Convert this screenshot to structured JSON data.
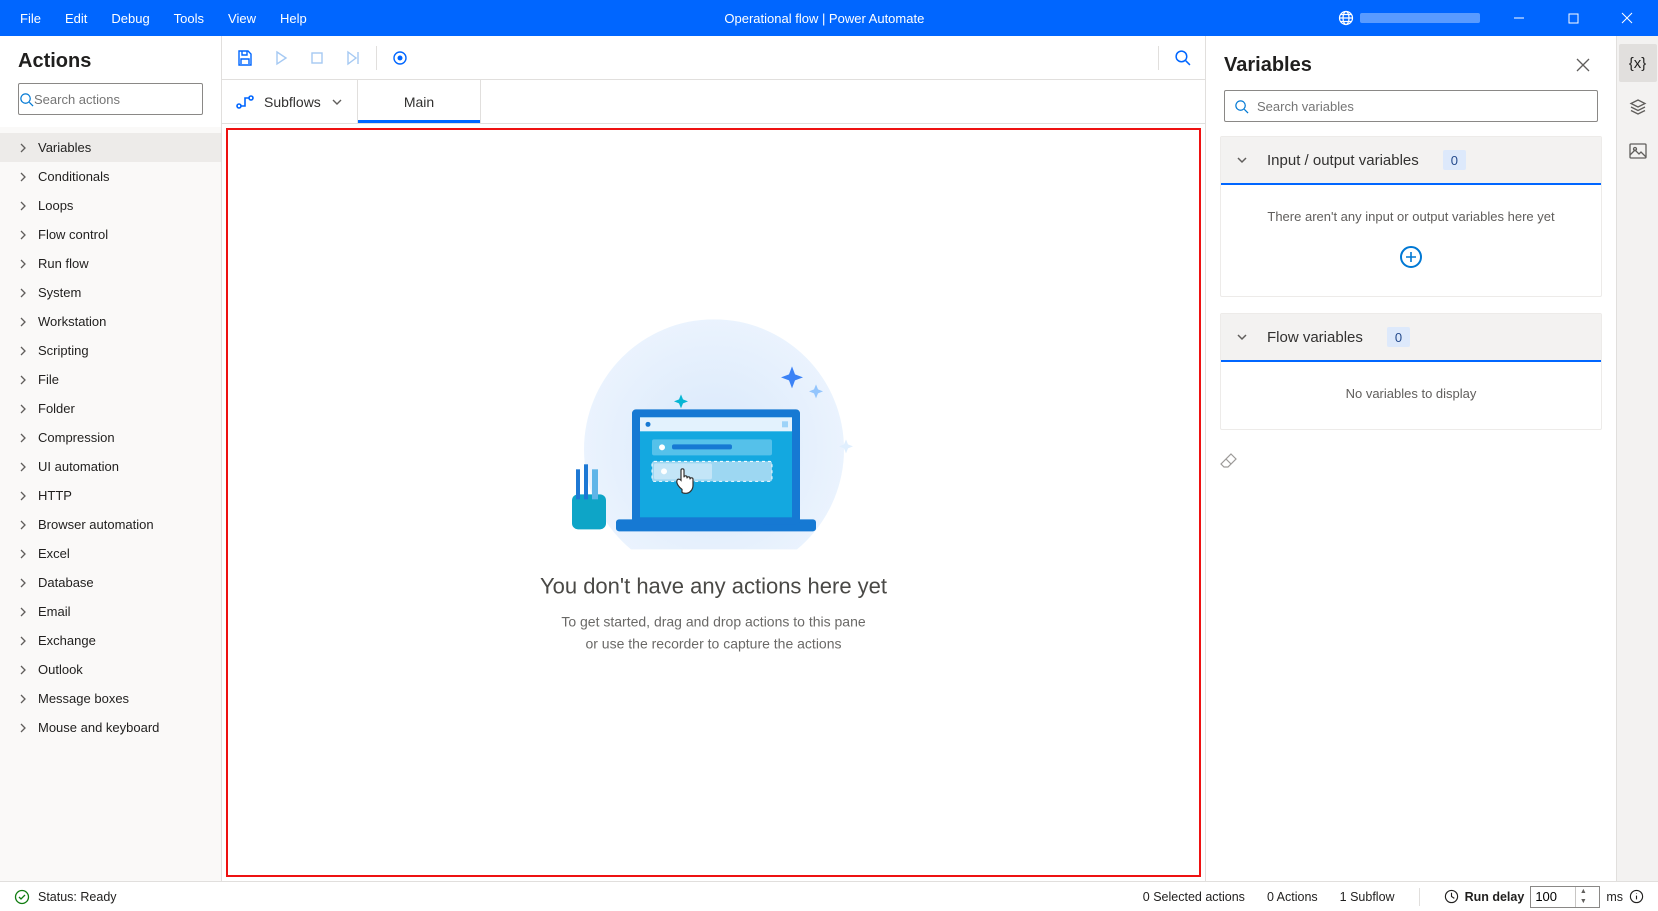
{
  "titlebar": {
    "menu": [
      "File",
      "Edit",
      "Debug",
      "Tools",
      "View",
      "Help"
    ],
    "title": "Operational flow | Power Automate"
  },
  "actions_panel": {
    "title": "Actions",
    "search_placeholder": "Search actions",
    "categories": [
      "Variables",
      "Conditionals",
      "Loops",
      "Flow control",
      "Run flow",
      "System",
      "Workstation",
      "Scripting",
      "File",
      "Folder",
      "Compression",
      "UI automation",
      "HTTP",
      "Browser automation",
      "Excel",
      "Database",
      "Email",
      "Exchange",
      "Outlook",
      "Message boxes",
      "Mouse and keyboard"
    ],
    "selected_index": 0
  },
  "workspace": {
    "subflows_label": "Subflows",
    "tabs": [
      {
        "label": "Main",
        "active": true
      }
    ],
    "empty": {
      "title": "You don't have any actions here yet",
      "line1": "To get started, drag and drop actions to this pane",
      "line2": "or use the recorder to capture the actions"
    }
  },
  "variables_panel": {
    "title": "Variables",
    "search_placeholder": "Search variables",
    "io_section": {
      "title": "Input / output variables",
      "count": "0",
      "empty_text": "There aren't any input or output variables here yet"
    },
    "flow_section": {
      "title": "Flow variables",
      "count": "0",
      "empty_text": "No variables to display"
    }
  },
  "statusbar": {
    "status": "Status: Ready",
    "selected_actions": "0 Selected actions",
    "actions": "0 Actions",
    "subflows": "1 Subflow",
    "run_delay_label": "Run delay",
    "run_delay_value": "100",
    "run_delay_unit": "ms"
  }
}
